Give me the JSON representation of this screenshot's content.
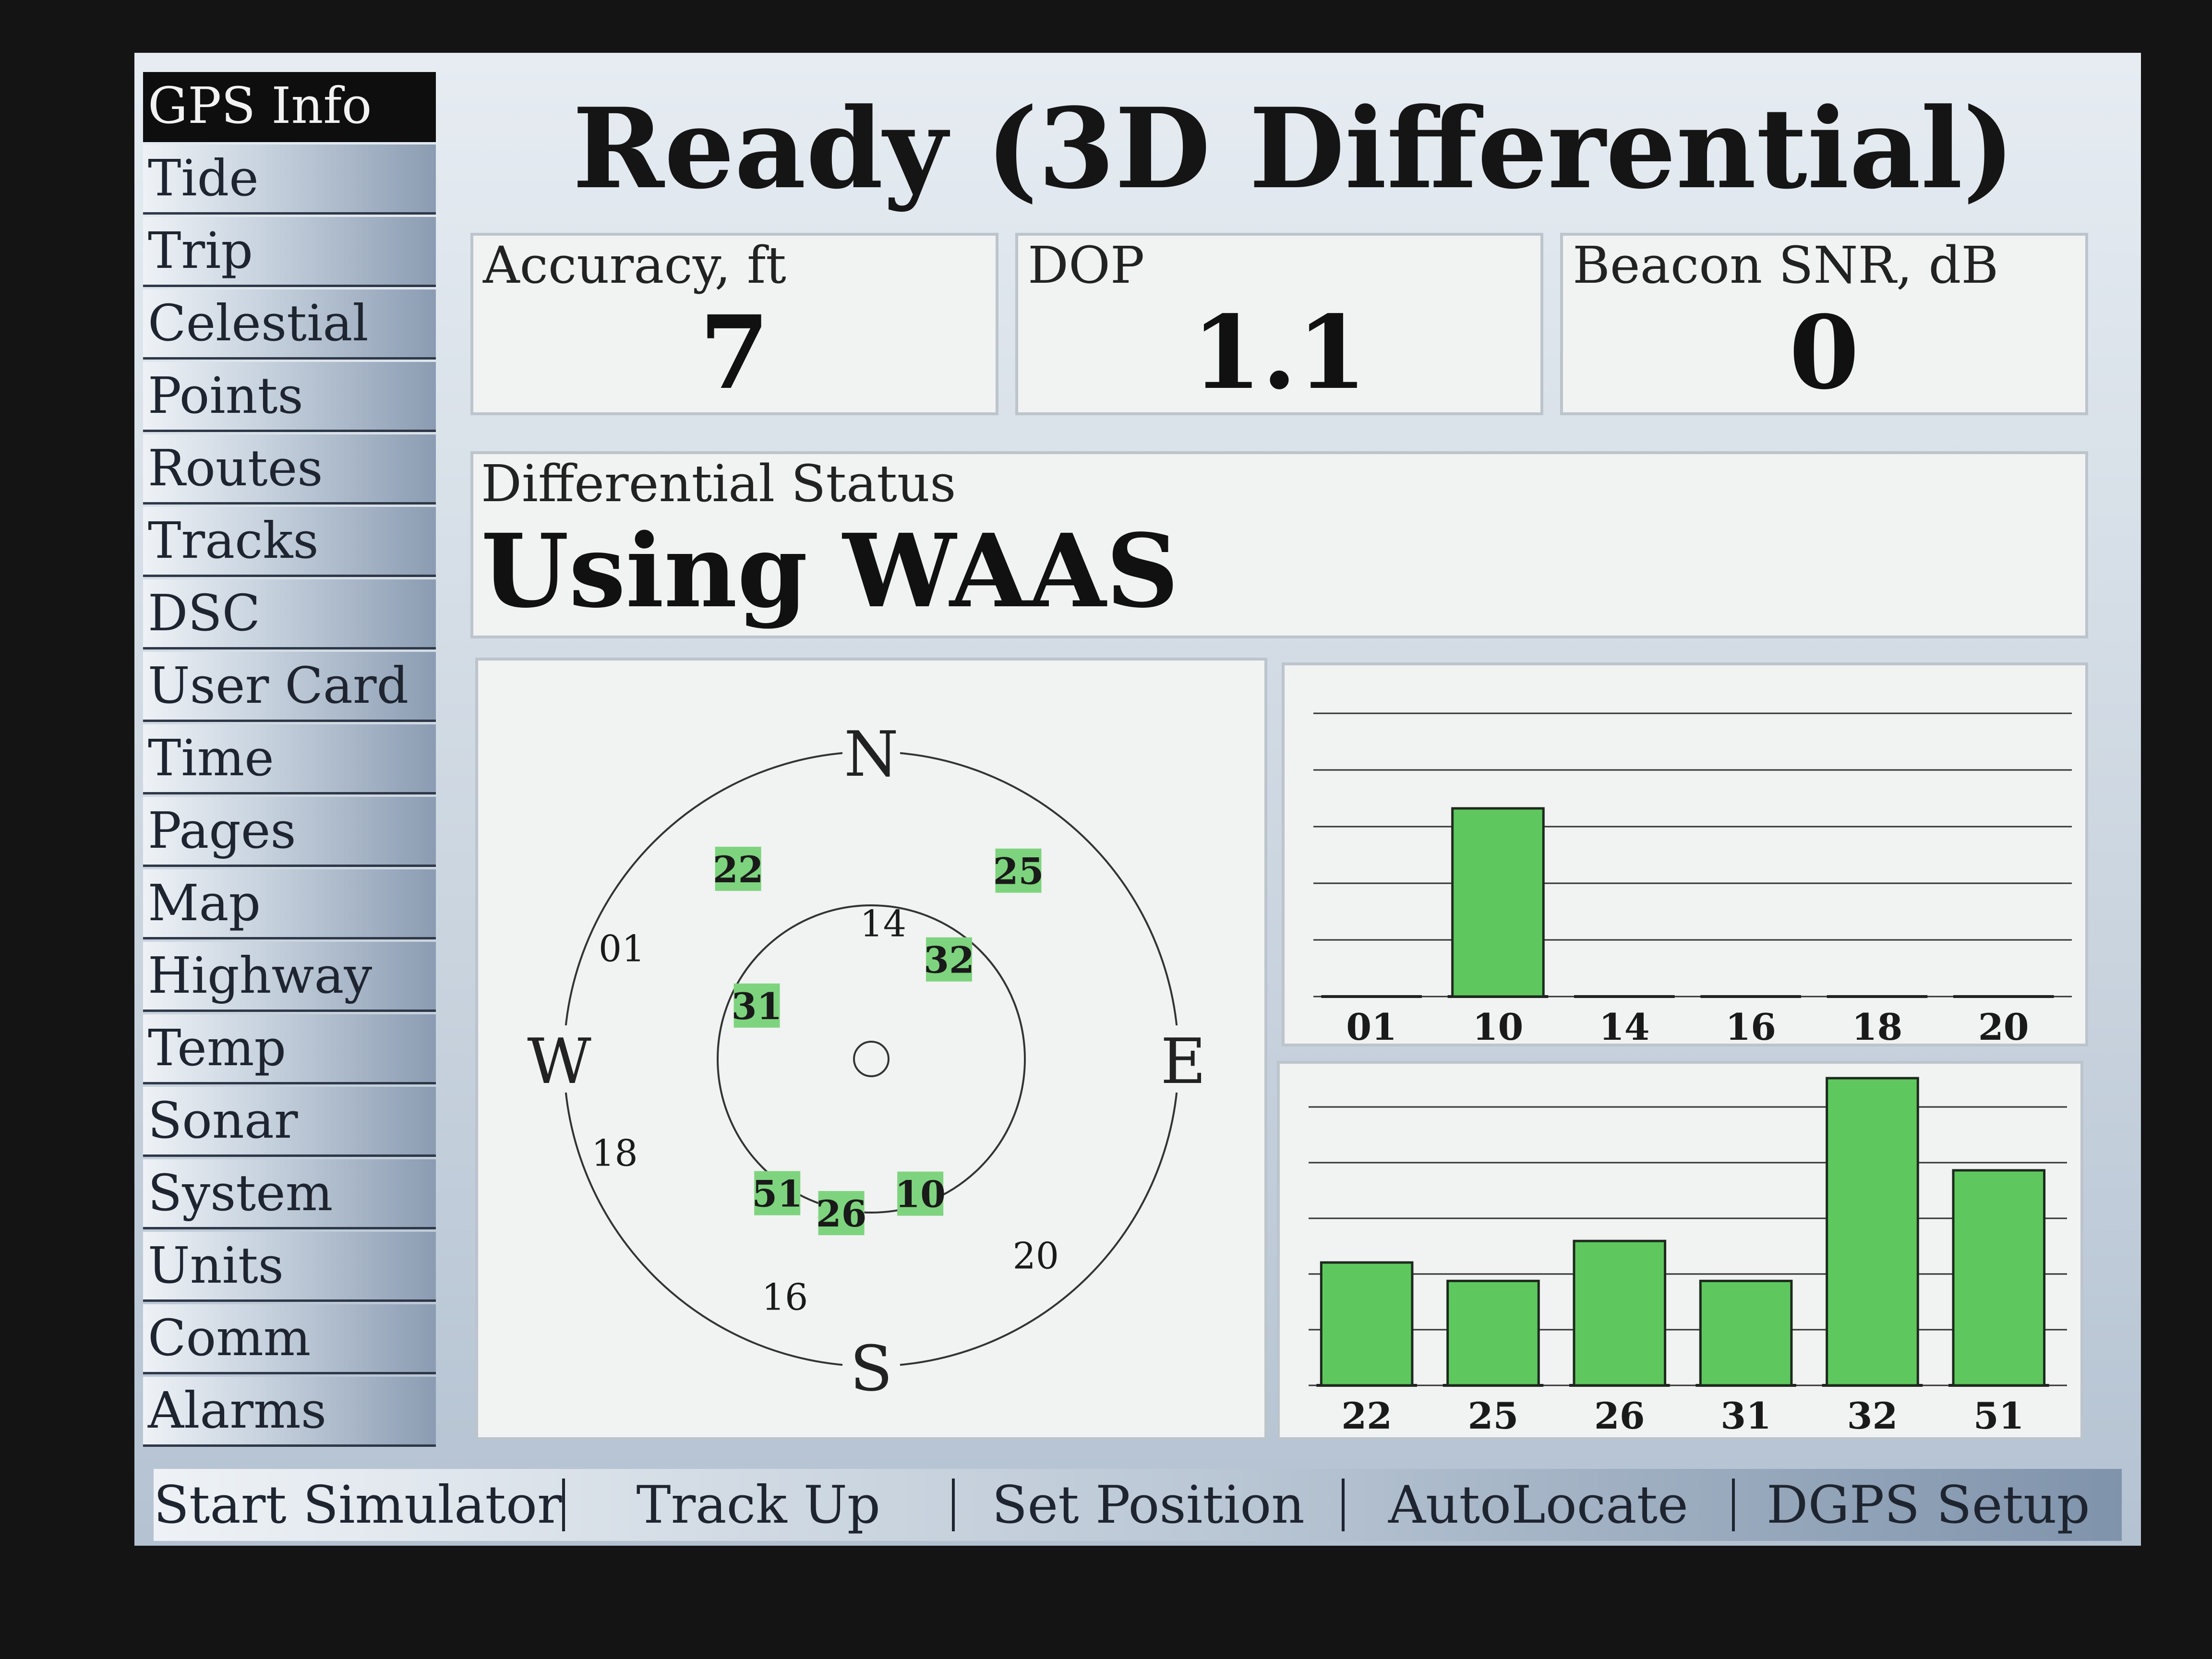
{
  "sidebar": {
    "items": [
      {
        "label": "GPS Info",
        "active": true
      },
      {
        "label": "Tide"
      },
      {
        "label": "Trip"
      },
      {
        "label": "Celestial"
      },
      {
        "label": "Points"
      },
      {
        "label": "Routes"
      },
      {
        "label": "Tracks"
      },
      {
        "label": "DSC"
      },
      {
        "label": "User Card"
      },
      {
        "label": "Time"
      },
      {
        "label": "Pages"
      },
      {
        "label": "Map"
      },
      {
        "label": "Highway"
      },
      {
        "label": "Temp"
      },
      {
        "label": "Sonar"
      },
      {
        "label": "System"
      },
      {
        "label": "Units"
      },
      {
        "label": "Comm"
      },
      {
        "label": "Alarms"
      }
    ]
  },
  "header": {
    "title": "Ready (3D Differential)"
  },
  "fields": {
    "accuracy": {
      "label": "Accuracy, ft",
      "value": "7"
    },
    "dop": {
      "label": "DOP",
      "value": "1.1"
    },
    "beacon": {
      "label": "Beacon SNR, dB",
      "value": "0"
    }
  },
  "differential": {
    "label": "Differential Status",
    "value": "Using WAAS"
  },
  "skyplot": {
    "compass": {
      "n": "N",
      "e": "E",
      "s": "S",
      "w": "W"
    },
    "satellites": [
      {
        "id": "22",
        "used": true,
        "az": 325,
        "el": 22
      },
      {
        "id": "25",
        "used": true,
        "az": 38,
        "el": 20
      },
      {
        "id": "14",
        "used": false,
        "az": 5,
        "el": 50
      },
      {
        "id": "32",
        "used": true,
        "az": 38,
        "el": 53
      },
      {
        "id": "31",
        "used": true,
        "az": 295,
        "el": 53
      },
      {
        "id": "01",
        "used": false,
        "az": 294,
        "el": 10
      },
      {
        "id": "18",
        "used": false,
        "az": 250,
        "el": 10
      },
      {
        "id": "51",
        "used": true,
        "az": 215,
        "el": 42
      },
      {
        "id": "26",
        "used": true,
        "az": 191,
        "el": 44
      },
      {
        "id": "10",
        "used": true,
        "az": 160,
        "el": 48
      },
      {
        "id": "20",
        "used": false,
        "az": 140,
        "el": 15
      },
      {
        "id": "16",
        "used": false,
        "az": 200,
        "el": 16
      }
    ]
  },
  "signal_bars": {
    "top": [
      {
        "id": "01",
        "strength": 0
      },
      {
        "id": "10",
        "strength": 0.7
      },
      {
        "id": "14",
        "strength": 0
      },
      {
        "id": "16",
        "strength": 0
      },
      {
        "id": "18",
        "strength": 0
      },
      {
        "id": "20",
        "strength": 0
      }
    ],
    "bottom": [
      {
        "id": "22",
        "strength": 0.4
      },
      {
        "id": "25",
        "strength": 0.34
      },
      {
        "id": "26",
        "strength": 0.47
      },
      {
        "id": "31",
        "strength": 0.34
      },
      {
        "id": "32",
        "strength": 1.0
      },
      {
        "id": "51",
        "strength": 0.7
      }
    ]
  },
  "softkeys": [
    "Start Simulator",
    "Track Up",
    "Set Position",
    "AutoLocate",
    "DGPS Setup"
  ],
  "colors": {
    "bar": "#5ec85e",
    "bar_dark": "#2f8f34",
    "sat_fill": "#7ed47e"
  }
}
